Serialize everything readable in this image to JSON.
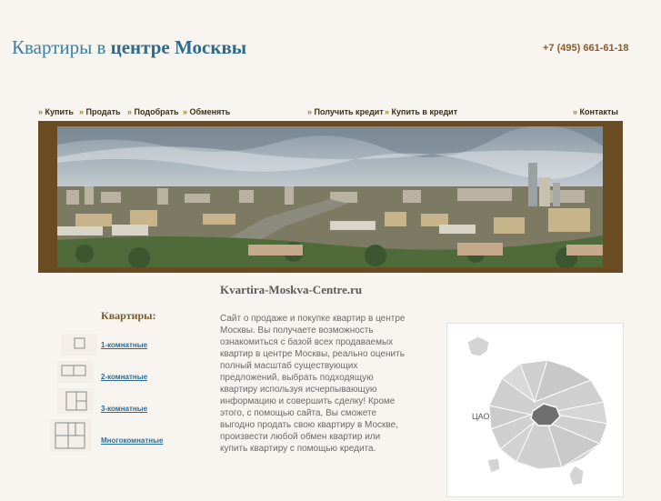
{
  "header": {
    "title_light": "Квартиры в",
    "title_bold": "центре Москвы",
    "phone": "+7 (495) 661-61-18"
  },
  "nav": {
    "buy": "Купить",
    "sell": "Продать",
    "select": "Подобрать",
    "exchange": "Обменять",
    "get_credit": "Получить кредит",
    "buy_credit": "Купить в кредит",
    "contacts": "Контакты"
  },
  "main": {
    "domain": "Kvartira-Moskva-Centre.ru",
    "description": "Сайт о продаже и покупке квартир в центре Москвы. Вы получаете возможность ознакомиться с базой всех продаваемых квартир в центре Москвы, реально оценить полный масштаб существующих предложений, выбрать подходящую квартиру используя исчерпывающую информацию и совершить сделку! Кроме этого, с помощью сайта, Вы сможете выгодно продать свою квартиру в Москве, произвести любой обмен квартир или купить квартиру с помощью кредита."
  },
  "sidebar": {
    "title": "Квартиры:",
    "items": [
      {
        "label": "1-комнатные"
      },
      {
        "label": "2-комнатные"
      },
      {
        "label": "3-комнатные"
      },
      {
        "label": "Многокомнатные"
      }
    ]
  },
  "map": {
    "label": "ЦАО"
  },
  "colors": {
    "background": "#f8f5f0",
    "banner_frame": "#6a4c22",
    "link": "#2c6b9a",
    "title": "#3b7ea1"
  }
}
